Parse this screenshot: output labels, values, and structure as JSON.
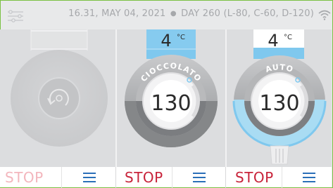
{
  "status_bar": {
    "time": "16.31,",
    "date": "MAY 04, 2021",
    "separator": "●",
    "day_info": "DAY 260 (L-80, C-60, D-120)",
    "menu_icon": "settings-sliders-icon",
    "wifi_icon": "wifi-icon"
  },
  "units": [
    {
      "id": "unit-1",
      "temperature": "",
      "program": "",
      "time_value": "",
      "level": 0,
      "stop_label": "STOP",
      "stop_active": false,
      "menu_icon": "hamburger-menu-icon"
    },
    {
      "id": "unit-2",
      "temperature": "4",
      "temperature_unit": "°C",
      "program": "CIOCCOLATO",
      "time_value": "130",
      "level": 0.5,
      "stop_label": "STOP",
      "stop_active": true,
      "menu_icon": "hamburger-menu-icon"
    },
    {
      "id": "unit-3",
      "temperature": "4",
      "temperature_unit": "°C",
      "program": "AUTO",
      "time_value": "130",
      "level": 0.35,
      "stop_label": "STOP",
      "stop_active": true,
      "menu_icon": "hamburger-menu-icon"
    }
  ],
  "colors": {
    "accent_blue": "#7fc8ee",
    "stop_active": "#c8233a",
    "stop_inactive": "#f3b6bd",
    "menu_blue": "#2a6fb8",
    "frame_green": "#7bc143"
  }
}
